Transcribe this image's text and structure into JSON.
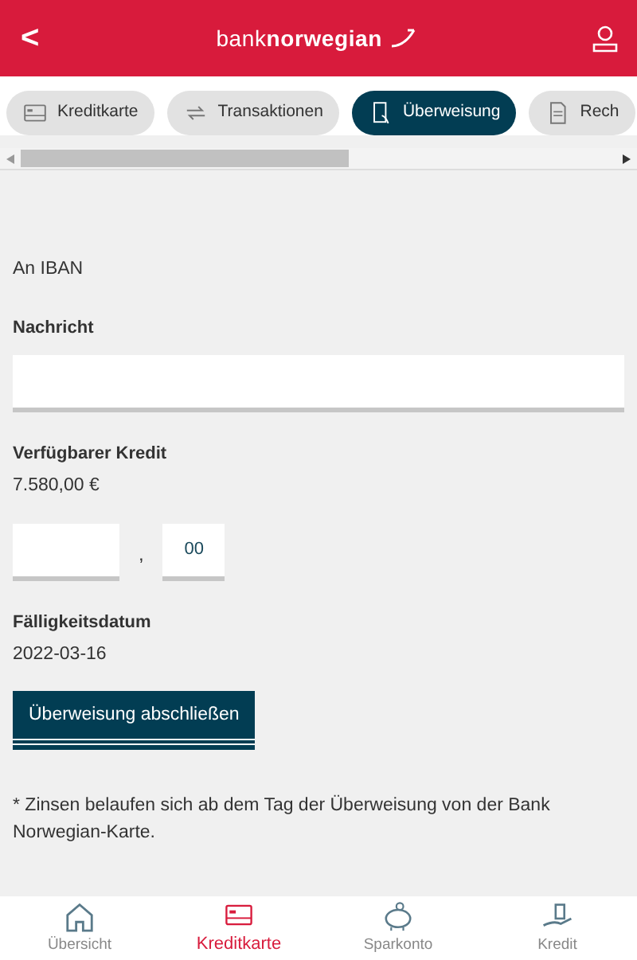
{
  "header": {
    "back": "<",
    "logo": "bank**norwegian**"
  },
  "tabs": [
    {
      "label": "Kreditkarte",
      "kind": "card",
      "selected": false
    },
    {
      "label": "Transaktionen",
      "kind": "arrows",
      "selected": false
    },
    {
      "label": "Überweisung",
      "kind": "phone",
      "selected": true
    },
    {
      "label": "Rech",
      "kind": "doc",
      "selected": false
    }
  ],
  "form": {
    "recipient": "An IBAN",
    "message_label": "Nachricht",
    "credit_label": "Verfügbarer Kredit",
    "credit_value": "7.580,00 €",
    "separator": ",",
    "cents_value": "00",
    "due_label": "Fälligkeitsdatum",
    "due_value": "2022-03-16",
    "submit": "Überweisung abschließen",
    "note": "* Zinsen belaufen sich ab dem Tag der Überweisung von der Bank Norwegian-Karte."
  },
  "bottom_nav": [
    {
      "label": "Übersicht",
      "kind": "house",
      "selected": false
    },
    {
      "label": "Kreditkarte",
      "kind": "card",
      "selected": true
    },
    {
      "label": "Sparkonto",
      "kind": "piggy",
      "selected": false
    },
    {
      "label": "Kredit",
      "kind": "hand",
      "selected": false
    }
  ]
}
